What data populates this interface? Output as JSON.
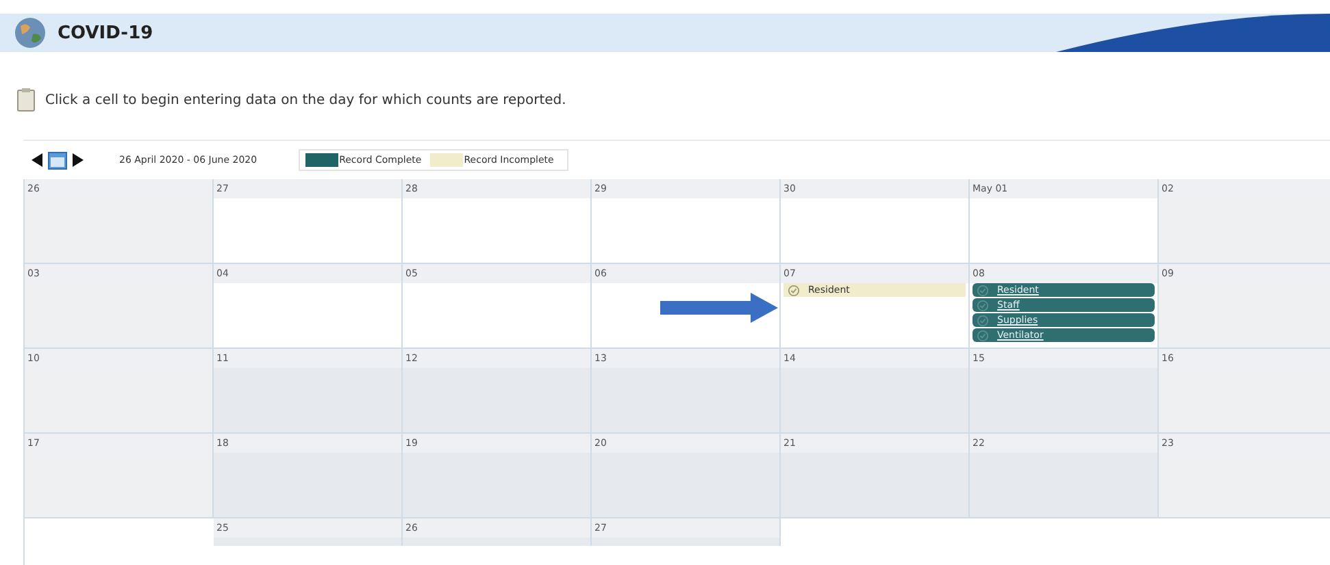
{
  "header": {
    "title": "COVID-19"
  },
  "instruction": "Click a cell to begin entering data on the day for which counts are reported.",
  "toolbar": {
    "range": "26 April 2020 - 06 June 2020",
    "legend": [
      {
        "label": "Record Complete",
        "color": "#1f6466"
      },
      {
        "label": "Record Incomplete",
        "color": "#f1eccc"
      }
    ]
  },
  "weeks": [
    [
      {
        "day": "26",
        "kind": "weekend"
      },
      {
        "day": "27",
        "kind": "open"
      },
      {
        "day": "28",
        "kind": "open"
      },
      {
        "day": "29",
        "kind": "open"
      },
      {
        "day": "30",
        "kind": "open"
      },
      {
        "day": "May 01",
        "kind": "open"
      },
      {
        "day": "02",
        "kind": "weekend"
      }
    ],
    [
      {
        "day": "03",
        "kind": "weekend"
      },
      {
        "day": "04",
        "kind": "open"
      },
      {
        "day": "05",
        "kind": "open"
      },
      {
        "day": "06",
        "kind": "open"
      },
      {
        "day": "07",
        "kind": "open",
        "entries": [
          {
            "label": "Resident",
            "complete": false
          }
        ]
      },
      {
        "day": "08",
        "kind": "open",
        "entries": [
          {
            "label": "Resident",
            "complete": true
          },
          {
            "label": "Staff",
            "complete": true
          },
          {
            "label": "Supplies",
            "complete": true
          },
          {
            "label": "Ventilator",
            "complete": true
          }
        ]
      },
      {
        "day": "09",
        "kind": "weekend"
      }
    ],
    [
      {
        "day": "10",
        "kind": "weekend"
      },
      {
        "day": "11",
        "kind": "future"
      },
      {
        "day": "12",
        "kind": "future"
      },
      {
        "day": "13",
        "kind": "future"
      },
      {
        "day": "14",
        "kind": "future"
      },
      {
        "day": "15",
        "kind": "future"
      },
      {
        "day": "16",
        "kind": "weekend"
      }
    ],
    [
      {
        "day": "17",
        "kind": "weekend"
      },
      {
        "day": "18",
        "kind": "future"
      },
      {
        "day": "19",
        "kind": "future"
      },
      {
        "day": "20",
        "kind": "future"
      },
      {
        "day": "21",
        "kind": "future"
      },
      {
        "day": "22",
        "kind": "future"
      },
      {
        "day": "23",
        "kind": "weekend"
      }
    ],
    [
      {
        "day": "25",
        "kind": "future"
      },
      {
        "day": "26",
        "kind": "future"
      },
      {
        "day": "27",
        "kind": "future"
      }
    ]
  ]
}
